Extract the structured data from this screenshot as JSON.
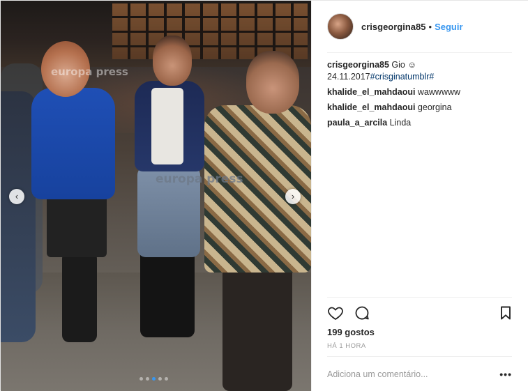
{
  "post": {
    "image": {
      "watermark_1": "europa press",
      "watermark_2": "europa press",
      "carousel_prev_icon": "chevron-left-icon",
      "carousel_next_icon": "chevron-right-icon",
      "carousel_total": 5,
      "carousel_active": 3
    },
    "header": {
      "username": "crisgeorgina85",
      "separator": "•",
      "follow_label": "Seguir"
    },
    "caption": {
      "username": "crisgeorgina85",
      "text": "Gio ☺",
      "date": "24.11.2017",
      "hashtag": "#crisginatumblr#"
    },
    "comments": [
      {
        "username": "khalide_el_mahdaoui",
        "text": "wawwwww"
      },
      {
        "username": "khalide_el_mahdaoui",
        "text": "georgina"
      },
      {
        "username": "paula_a_arcila",
        "text": "Linda"
      }
    ],
    "actions": {
      "like_icon": "heart-icon",
      "comment_icon": "speech-bubble-icon",
      "save_icon": "bookmark-icon"
    },
    "likes_text": "199 gostos",
    "time_text": "HÁ 1 HORA",
    "add_comment_placeholder": "Adiciona um comentário...",
    "more_label": "•••"
  },
  "colors": {
    "link_blue": "#3897f0",
    "hashtag_blue": "#003569",
    "text": "#262626",
    "muted": "#999999"
  }
}
